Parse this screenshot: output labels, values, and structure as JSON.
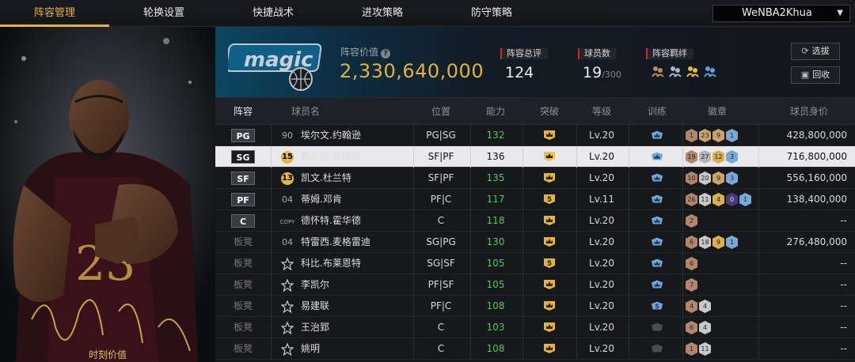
{
  "nav": {
    "tabs": [
      "阵容管理",
      "轮换设置",
      "快捷战术",
      "进攻策略",
      "防守策略"
    ],
    "active_index": 0,
    "user": "WeNBA2Khua"
  },
  "art": {
    "caption": "时刻价值"
  },
  "header": {
    "lineup_value_label": "阵容价值",
    "lineup_value": "2,330,640,000",
    "overall_label": "阵容总评",
    "overall_value": "124",
    "players_label": "球员数",
    "players_value": "19",
    "players_max": "/300",
    "chem_label": "阵容羁绊",
    "pick_button": "选拔",
    "recycle_button": "回收"
  },
  "table": {
    "columns": [
      "阵容",
      "球员名",
      "位置",
      "能力",
      "突破",
      "等级",
      "训练",
      "徽章",
      "球员身价"
    ],
    "rows": [
      {
        "slot": "PG",
        "num": "90",
        "num_style": "plain",
        "name": "埃尔文.约翰逊",
        "pos": "PG|SG",
        "ovr": "132",
        "green": true,
        "break": "crown",
        "lv": "Lv.20",
        "train": "crown",
        "badges": [
          [
            "1",
            "#b0876c"
          ],
          [
            "23",
            "#c9a36b"
          ],
          [
            "9",
            "#c9a36b"
          ],
          [
            "1",
            "#7aa8d6"
          ]
        ],
        "value": "428,800,000",
        "selected": false
      },
      {
        "slot": "SG",
        "num": "15",
        "num_style": "gold",
        "name": "勒布朗.詹姆斯",
        "pos": "SF|PF",
        "ovr": "136",
        "green": false,
        "break": "crown",
        "lv": "Lv.20",
        "train": "crown",
        "badges": [
          [
            "19",
            "#b0876c"
          ],
          [
            "27",
            "#b5b5b5"
          ],
          [
            "12",
            "#d7b14f"
          ],
          [
            "3",
            "#7aa8d6"
          ]
        ],
        "value": "716,800,000",
        "selected": true
      },
      {
        "slot": "SF",
        "num": "13",
        "num_style": "gold",
        "name": "凯文.杜兰特",
        "pos": "SF|PF",
        "ovr": "135",
        "green": true,
        "break": "crown",
        "lv": "Lv.20",
        "train": "crown",
        "badges": [
          [
            "10",
            "#b0876c"
          ],
          [
            "20",
            "#c9c9c9"
          ],
          [
            "9",
            "#c9a36b"
          ],
          [
            "3",
            "#7aa8d6"
          ]
        ],
        "value": "556,160,000",
        "selected": false
      },
      {
        "slot": "PF",
        "num": "04",
        "num_style": "plain",
        "name": "蒂姆.邓肯",
        "pos": "PF|C",
        "ovr": "117",
        "green": true,
        "break": "5",
        "lv": "Lv.11",
        "train": "crown",
        "badges": [
          [
            "26",
            "#b0876c"
          ],
          [
            "11",
            "#c9c9c9"
          ],
          [
            "4",
            "#d7b14f"
          ],
          [
            "0",
            "#4a3b7a"
          ],
          [
            "1",
            "#7aa8d6"
          ]
        ],
        "value": "138,400,000",
        "selected": false
      },
      {
        "slot": "C",
        "num": "COPY",
        "num_style": "copy",
        "name": "德怀特.霍华德",
        "pos": "C",
        "ovr": "118",
        "green": true,
        "break": "crown",
        "lv": "Lv.20",
        "train": "crown",
        "badges": [
          [
            "2",
            "#b0876c"
          ]
        ],
        "value": "--",
        "selected": false
      },
      {
        "slot": "板凳",
        "num": "04",
        "num_style": "plain",
        "name": "特雷西.麦格雷迪",
        "pos": "SG|PG",
        "ovr": "130",
        "green": true,
        "break": "crown",
        "lv": "Lv.20",
        "train": "crown",
        "badges": [
          [
            "6",
            "#b0876c"
          ],
          [
            "18",
            "#c9c9c9"
          ],
          [
            "9",
            "#d7b14f"
          ],
          [
            "1",
            "#7aa8d6"
          ]
        ],
        "value": "276,480,000",
        "selected": false
      },
      {
        "slot": "板凳",
        "num": "",
        "num_style": "star",
        "name": "科比.布莱恩特",
        "pos": "SG|SF",
        "ovr": "105",
        "green": true,
        "break": "5",
        "lv": "Lv.20",
        "train": "crown",
        "badges": [
          [
            "6",
            "#b0876c"
          ]
        ],
        "value": "--",
        "selected": false
      },
      {
        "slot": "板凳",
        "num": "",
        "num_style": "star",
        "name": "李凯尔",
        "pos": "PF|SF",
        "ovr": "105",
        "green": true,
        "break": "crown",
        "lv": "Lv.20",
        "train": "crown",
        "badges": [
          [
            "7",
            "#b0876c"
          ]
        ],
        "value": "--",
        "selected": false
      },
      {
        "slot": "板凳",
        "num": "",
        "num_style": "star",
        "name": "易建联",
        "pos": "PF|C",
        "ovr": "108",
        "green": true,
        "break": "crown",
        "lv": "Lv.20",
        "train": "5",
        "badges": [
          [
            "4",
            "#b0876c"
          ],
          [
            "4",
            "#c9c9c9"
          ]
        ],
        "value": "--",
        "selected": false
      },
      {
        "slot": "板凳",
        "num": "",
        "num_style": "star",
        "name": "王治郅",
        "pos": "C",
        "ovr": "103",
        "green": true,
        "break": "crown",
        "lv": "Lv.20",
        "train": "none",
        "badges": [
          [
            "6",
            "#b0876c"
          ],
          [
            "4",
            "#c9c9c9"
          ]
        ],
        "value": "--",
        "selected": false
      },
      {
        "slot": "板凳",
        "num": "",
        "num_style": "star",
        "name": "姚明",
        "pos": "C",
        "ovr": "108",
        "green": true,
        "break": "crown",
        "lv": "Lv.20",
        "train": "none",
        "badges": [
          [
            "1",
            "#b0876c"
          ],
          [
            "11",
            "#c9c9c9"
          ]
        ],
        "value": "--",
        "selected": false
      }
    ]
  },
  "colors": {
    "accent": "#e3b341",
    "green": "#57c26a",
    "red": "#cc2a2a"
  }
}
